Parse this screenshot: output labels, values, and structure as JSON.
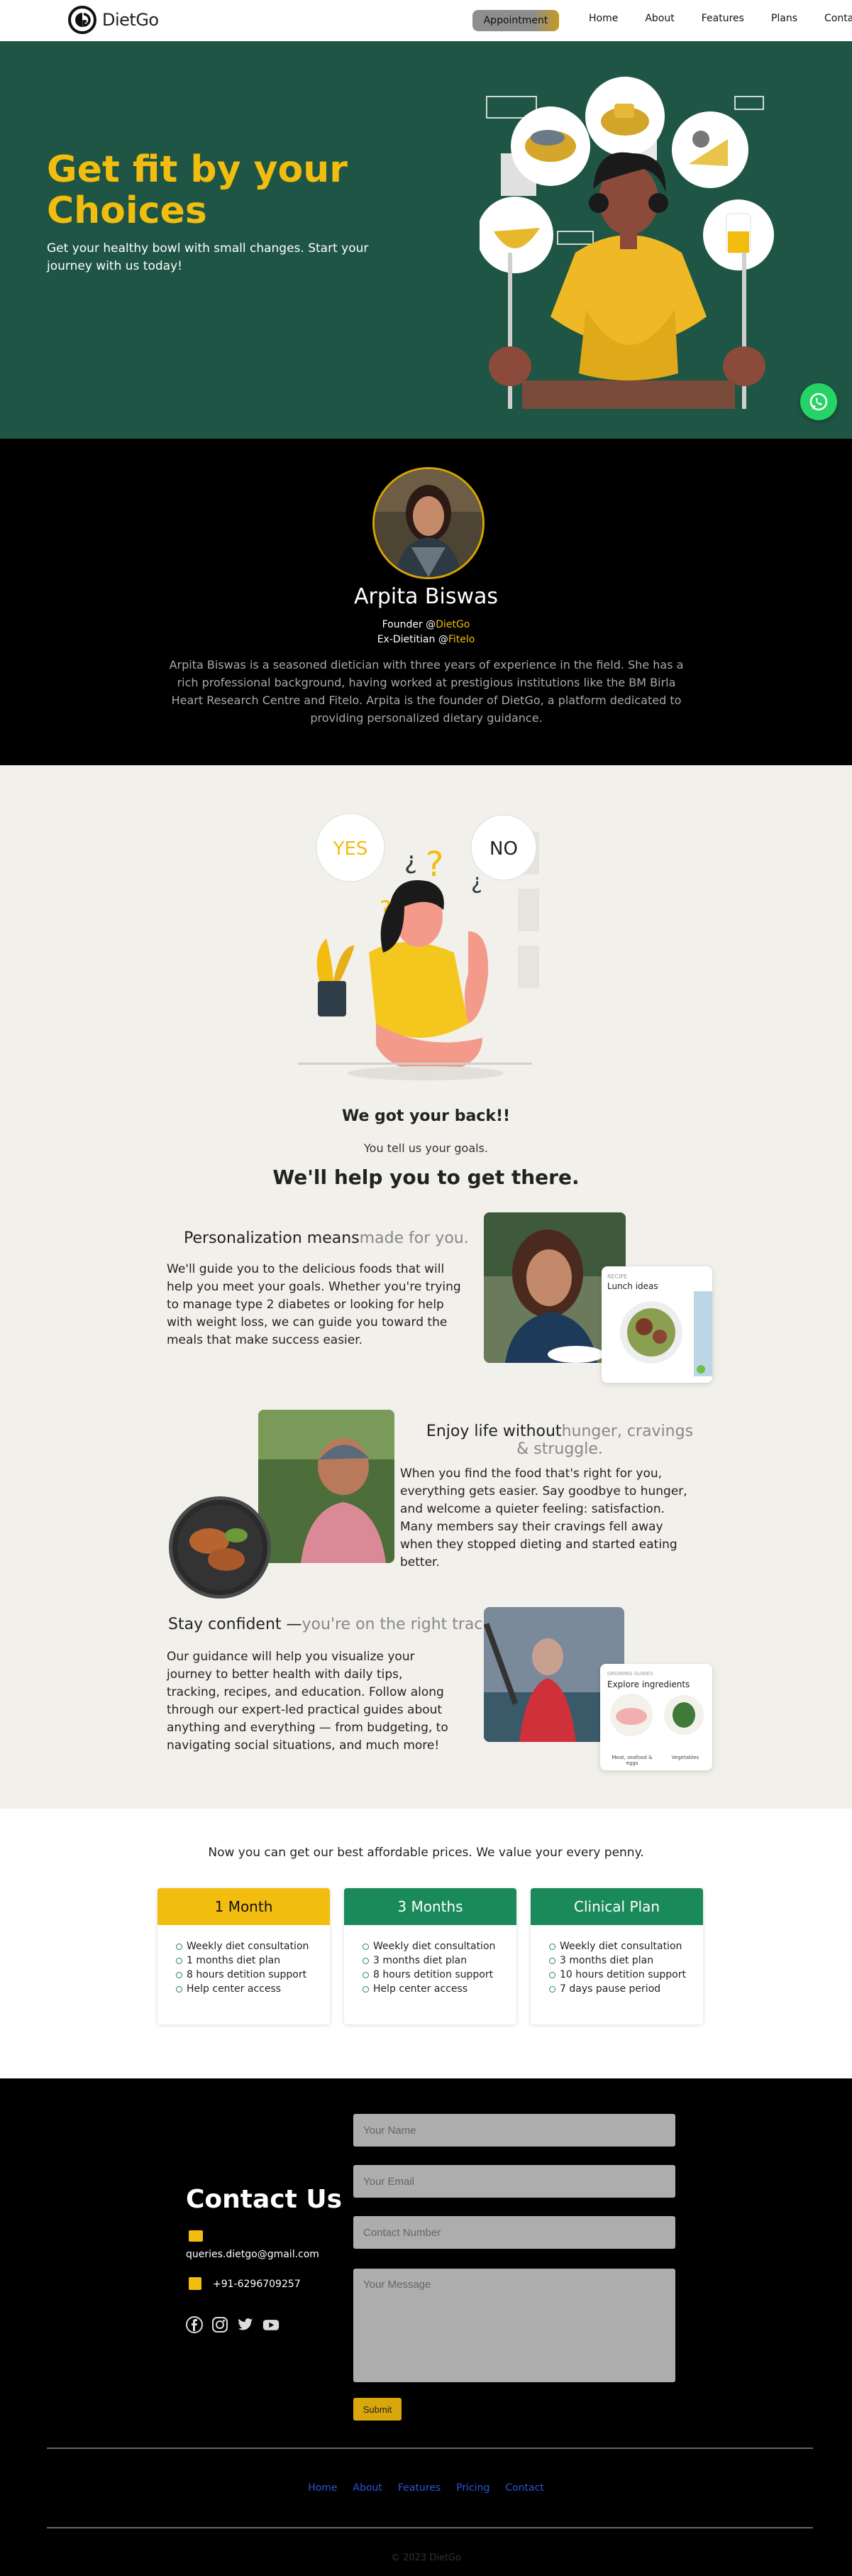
{
  "nav": {
    "brand": "DietGo",
    "appointment_label": "Appointment",
    "links": [
      "Home",
      "About",
      "Features",
      "Plans",
      "Contact"
    ]
  },
  "hero": {
    "title": "Get fit by your Choices",
    "subtitle": "Get your healthy bowl with small changes. Start your journey with us today!"
  },
  "profile": {
    "name": "Arpita Biswas",
    "role1_prefix": "Founder @",
    "role1_org": "DietGo",
    "role2_prefix": "Ex-Dietitian @",
    "role2_org": "Fitelo",
    "bio": "Arpita Biswas is a seasoned dietician with three years of experience in the field. She has a rich professional background, having worked at prestigious institutions like the BM Birla Heart Research Centre and Fitelo. Arpita is the founder of DietGo, a platform dedicated to providing personalized dietary guidance."
  },
  "intro": {
    "yes_label": "YES",
    "no_label": "NO",
    "got_back": "We got your back!!",
    "tell_us": "You tell us your goals.",
    "get_there": "We'll help you to get there."
  },
  "features": [
    {
      "title_bold": "Personalization means",
      "title_light": "made for you.",
      "body": "We'll guide you to the delicious foods that will help you meet your goals. Whether you're trying to manage type 2 diabetes or looking for help with weight loss, we can guide you toward the meals that make success easier.",
      "card_kicker": "RECIPE",
      "card_title": "Lunch ideas"
    },
    {
      "title_bold": "Enjoy life without",
      "title_light": "hunger, cravings & struggle.",
      "body": "When you find the food that's right for you, everything gets easier. Say goodbye to hunger, and welcome a quieter feeling: satisfaction. Many members say their cravings fell away when they stopped dieting and started eating better."
    },
    {
      "title_bold": "Stay confident —",
      "title_light": "you're on the right track.",
      "body": "Our guidance will help you visualize your journey to better health with daily tips, tracking, recipes, and education. Follow along through our expert-led practical guides about anything and everything — from budgeting, to navigating social situations, and much more!",
      "card_kicker": "GROWING GUIDES",
      "card_title": "Explore ingredients",
      "card_item1": "Meat, seafood & eggs",
      "card_item2": "Vegetables"
    }
  ],
  "pricing": {
    "intro": "Now you can get our best affordable prices. We value your every penny.",
    "plans": [
      {
        "name": "1 Month",
        "color": "#f2bd0e",
        "text_color": "#111",
        "items": [
          "Weekly diet consultation",
          "1 months diet plan",
          "8 hours detition support",
          "Help center access"
        ]
      },
      {
        "name": "3 Months",
        "color": "#1b8a5a",
        "text_color": "#fff",
        "items": [
          "Weekly diet consultation",
          "3 months diet plan",
          "8 hours detition support",
          "Help center access"
        ]
      },
      {
        "name": "Clinical Plan",
        "color": "#1b8a5a",
        "text_color": "#fff",
        "items": [
          "Weekly diet consultation",
          "3 months diet plan",
          "10 hours detition support",
          "7 days pause period"
        ]
      }
    ]
  },
  "contact": {
    "title": "Contact Us",
    "email": "queries.dietgo@gmail.com",
    "phone": "+91-6296709257",
    "name_placeholder": "Your Name",
    "email_placeholder": "Your Email",
    "number_placeholder": "Contact Number",
    "message_placeholder": "Your Message",
    "submit_label": "Submit",
    "social_icons": [
      "facebook-icon",
      "instagram-icon",
      "twitter-icon",
      "youtube-icon"
    ]
  },
  "footer": {
    "links": [
      "Home",
      "About",
      "Features",
      "Pricing",
      "Contact"
    ],
    "copyright": "© 2023 DietGo"
  },
  "colors": {
    "accent": "#f2bd0e",
    "hero_bg": "#1e5545",
    "green": "#1b8a5a",
    "whatsapp": "#25d366"
  }
}
